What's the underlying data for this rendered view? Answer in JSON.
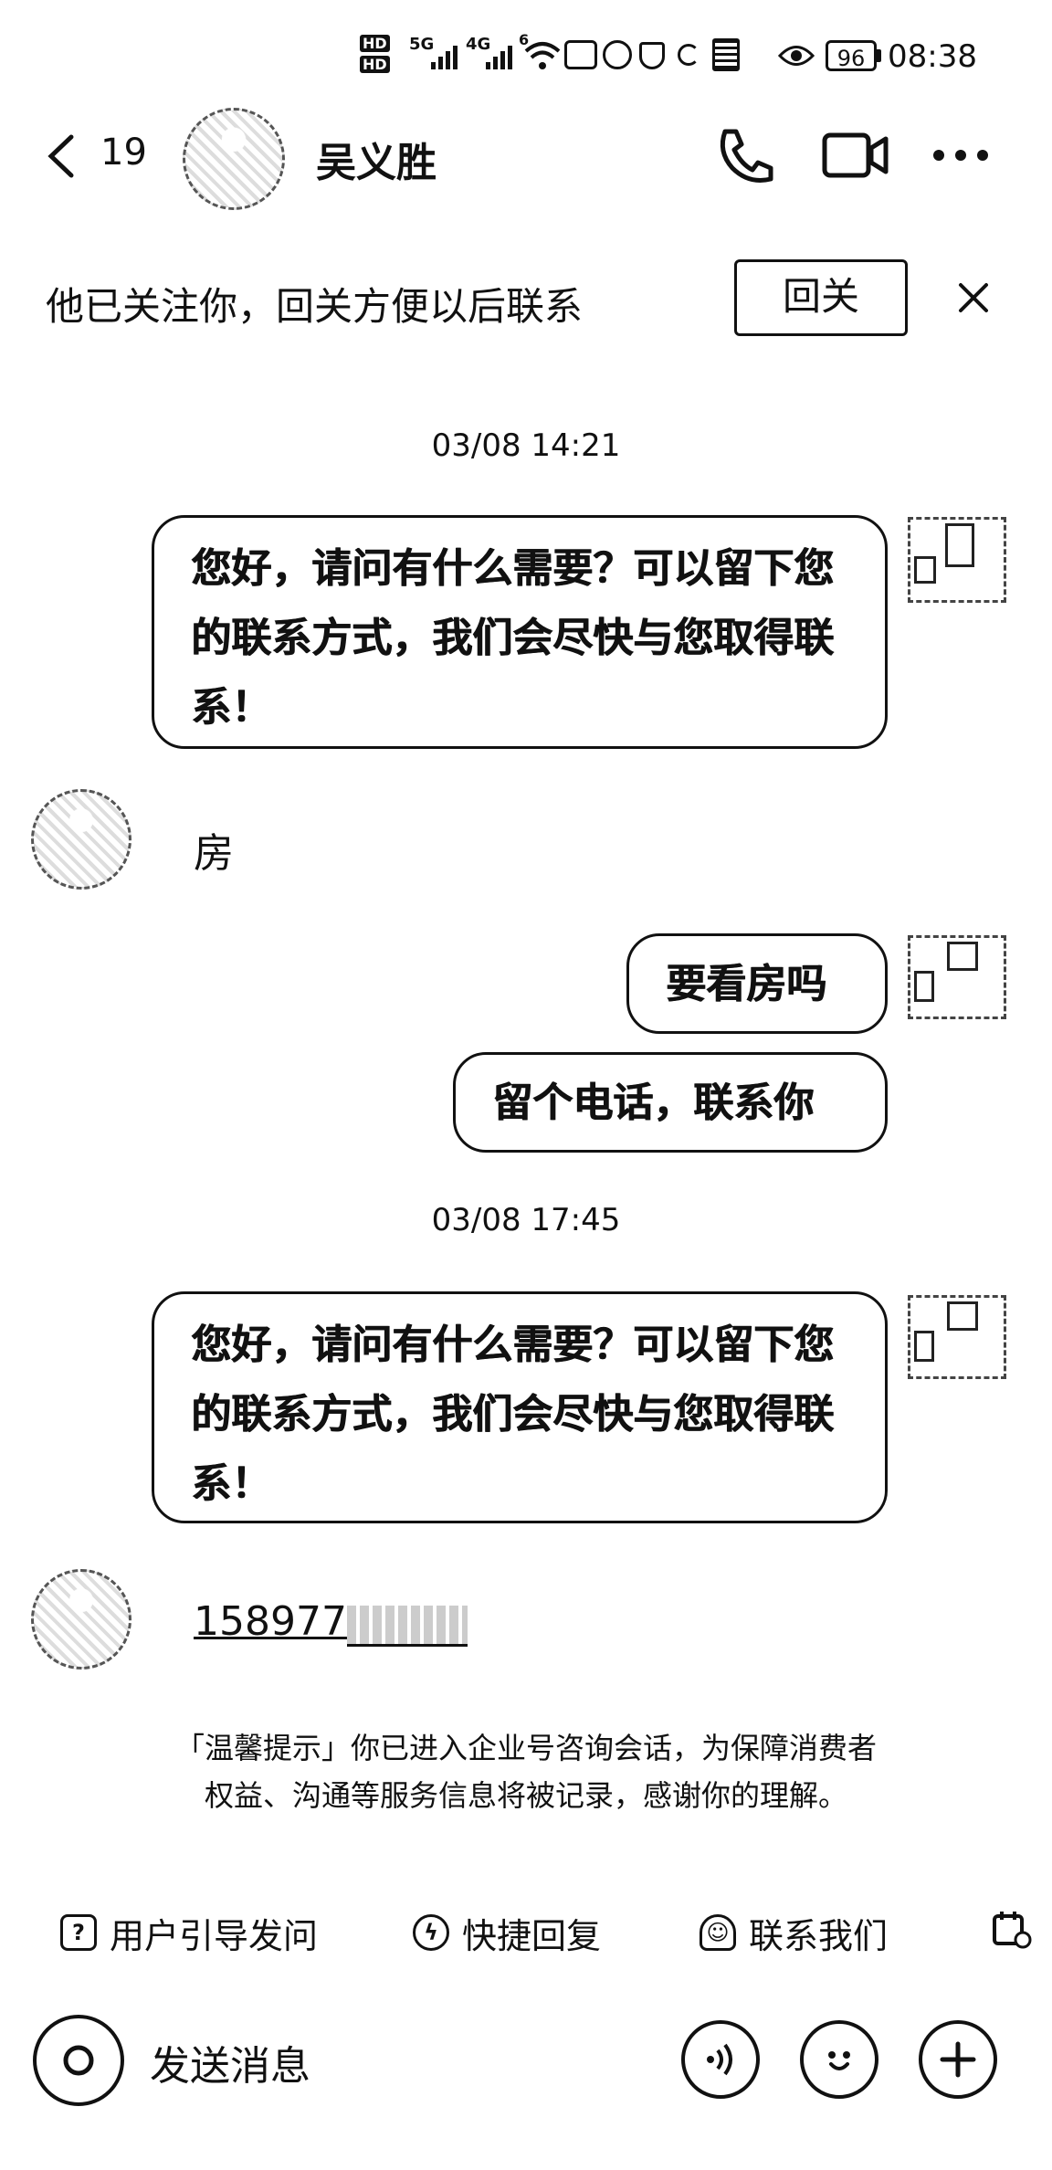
{
  "status_bar": {
    "hd1": "HD",
    "hd2": "HD",
    "net1": "5G",
    "net2": "4G",
    "wifi": "6",
    "battery": "96",
    "time": "08:38"
  },
  "header": {
    "back_count": "19",
    "contact_name": "吴义胜"
  },
  "follow_banner": {
    "text": "他已关注你，回关方便以后联系",
    "button": "回关"
  },
  "messages": {
    "time1": "03/08 14:21",
    "auto_reply_1": "您好，请问有什么需要？可以留下您的联系方式，我们会尽快与您取得联系！",
    "in_1": "房",
    "out_1": "要看房吗",
    "out_2": "留个电话，联系你",
    "time2": "03/08 17:45",
    "auto_reply_2": "您好，请问有什么需要？可以留下您的联系方式，我们会尽快与您取得联系！",
    "in_phone": "158977"
  },
  "notice": {
    "line1": "「温馨提示」你已进入企业号咨询会话，为保障消费者",
    "line2": "权益、沟通等服务信息将被记录，感谢你的理解。"
  },
  "quick_actions": [
    {
      "label": "用户引导发问"
    },
    {
      "label": "快捷回复"
    },
    {
      "label": "联系我们"
    }
  ],
  "input": {
    "placeholder": "发送消息"
  }
}
